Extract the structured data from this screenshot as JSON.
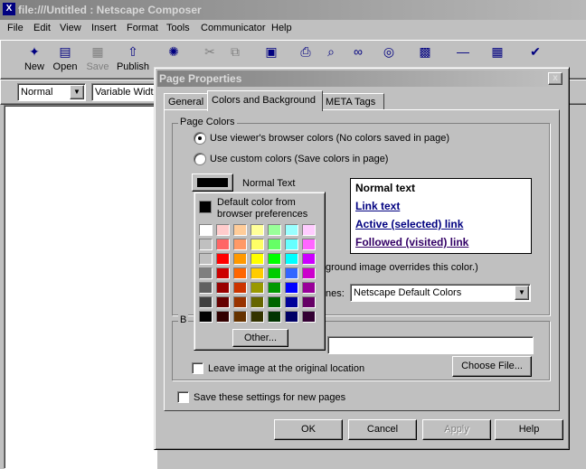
{
  "window": {
    "title": "file:///Untitled : Netscape Composer"
  },
  "menu": [
    "File",
    "Edit",
    "View",
    "Insert",
    "Format",
    "Tools",
    "Communicator",
    "Help"
  ],
  "toolbar": {
    "new": "New",
    "open": "Open",
    "save": "Save",
    "publish": "Publish",
    "preview": "Preview",
    "cut": "Cut",
    "copy": "Copy",
    "paste": "Paste",
    "print": "Print",
    "find": "Find",
    "link": "Link",
    "target": "Target",
    "image": "Image",
    "hline": "H. Line",
    "table": "Table",
    "spelling": "Spelling"
  },
  "format_bar": {
    "style": "Normal",
    "font": "Variable Width"
  },
  "dialog": {
    "title": "Page Properties",
    "close": "x",
    "tabs": [
      "General",
      "Colors and Background",
      "META Tags"
    ],
    "page_colors_label": "Page Colors",
    "radio_browser": "Use viewer's browser colors (No colors saved in page)",
    "radio_custom": "Use custom colors (Save colors in page)",
    "normal_text_label": "Normal Text",
    "preview": {
      "normal": "Normal text",
      "link": "Link text",
      "active": "Active (selected) link",
      "followed": "Followed (visited) link"
    },
    "bg_note": "ground image overrides this color.)",
    "schemes_label": "nes:",
    "schemes_value": "Netscape Default Colors",
    "bg_image_label": "B",
    "leave_image": "Leave image at the original location",
    "choose_file": "Choose File...",
    "save_settings": "Save these settings for new pages",
    "ok": "OK",
    "cancel": "Cancel",
    "apply": "Apply",
    "help": "Help"
  },
  "color_popup": {
    "default_label_1": "Default color from",
    "default_label_2": "browser preferences",
    "other": "Other...",
    "palette": [
      [
        "#ffffff",
        "#ffcccc",
        "#ffcc99",
        "#ffff99",
        "#99ff99",
        "#99ffff",
        "#ffccff"
      ],
      [
        "#c0c0c0",
        "#ff6666",
        "#ff9966",
        "#ffff66",
        "#66ff66",
        "#66ffff",
        "#ff66ff"
      ],
      [
        "#c0c0c0",
        "#ff0000",
        "#ff9900",
        "#ffff00",
        "#00ff00",
        "#00ffff",
        "#cc00ff"
      ],
      [
        "#808080",
        "#cc0000",
        "#ff6600",
        "#ffcc00",
        "#00cc00",
        "#3366ff",
        "#cc00cc"
      ],
      [
        "#606060",
        "#990000",
        "#cc3300",
        "#999900",
        "#009900",
        "#0000ff",
        "#990099"
      ],
      [
        "#404040",
        "#660000",
        "#993300",
        "#666600",
        "#006600",
        "#000099",
        "#660066"
      ],
      [
        "#000000",
        "#330000",
        "#663300",
        "#333300",
        "#003300",
        "#000066",
        "#330033"
      ]
    ]
  },
  "colors": {
    "preview_link": "#000080",
    "preview_followed": "#330066"
  }
}
